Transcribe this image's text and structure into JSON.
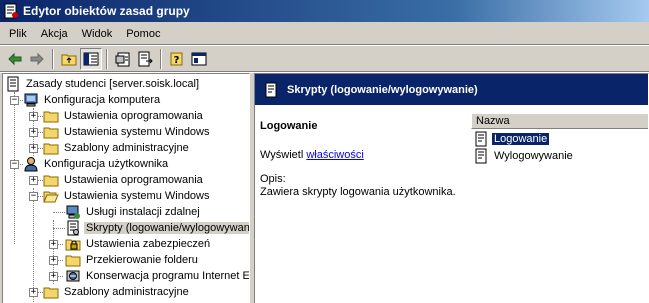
{
  "window": {
    "title": "Edytor obiektów zasad grupy"
  },
  "menu": {
    "items": [
      {
        "label": "Plik"
      },
      {
        "label": "Akcja"
      },
      {
        "label": "Widok"
      },
      {
        "label": "Pomoc"
      }
    ]
  },
  "toolbar": {
    "buttons": [
      "back-arrow-icon",
      "forward-arrow-icon",
      "up-folder-icon",
      "show-hide-tree-icon",
      "properties-icon",
      "export-list-icon",
      "help-icon",
      "console-view-icon"
    ]
  },
  "tree": {
    "items": [
      {
        "label": "Zasady studenci [server.soisk.local]",
        "icon": "policy-scroll-icon"
      },
      {
        "label": "Konfiguracja komputera",
        "icon": "computer-icon"
      },
      {
        "label": "Ustawienia oprogramowania",
        "icon": "folder-icon"
      },
      {
        "label": "Ustawienia systemu Windows",
        "icon": "folder-icon"
      },
      {
        "label": "Szablony administracyjne",
        "icon": "folder-icon"
      },
      {
        "label": "Konfiguracja użytkownika",
        "icon": "user-icon"
      },
      {
        "label": "Ustawienia oprogramowania",
        "icon": "folder-icon"
      },
      {
        "label": "Ustawienia systemu Windows",
        "icon": "folder-icon"
      },
      {
        "label": "Usługi instalacji zdalnej",
        "icon": "remote-install-icon"
      },
      {
        "label": "Skrypty (logowanie/wylogowywanie)",
        "icon": "script-icon"
      },
      {
        "label": "Ustawienia zabezpieczeń",
        "icon": "security-icon"
      },
      {
        "label": "Przekierowanie folderu",
        "icon": "folder-icon"
      },
      {
        "label": "Konserwacja programu Internet Explorer",
        "icon": "ie-maintenance-icon"
      },
      {
        "label": "Szablony administracyjne",
        "icon": "folder-icon"
      }
    ]
  },
  "right": {
    "header_title": "Skrypty (logowanie/wylogowywanie)",
    "description": {
      "title": "Logowanie",
      "show_prefix": "Wyświetl",
      "show_link": "właściwości",
      "opis_label": "Opis:",
      "opis_text": "Zawiera skrypty logowania użytkownika."
    },
    "list": {
      "column": "Nazwa",
      "items": [
        {
          "label": "Logowanie"
        },
        {
          "label": "Wylogowywanie"
        }
      ]
    }
  },
  "colors": {
    "titlebar": "#0a246a",
    "selection": "#0a246a",
    "face": "#d4d0c8",
    "link": "#0000ff"
  }
}
